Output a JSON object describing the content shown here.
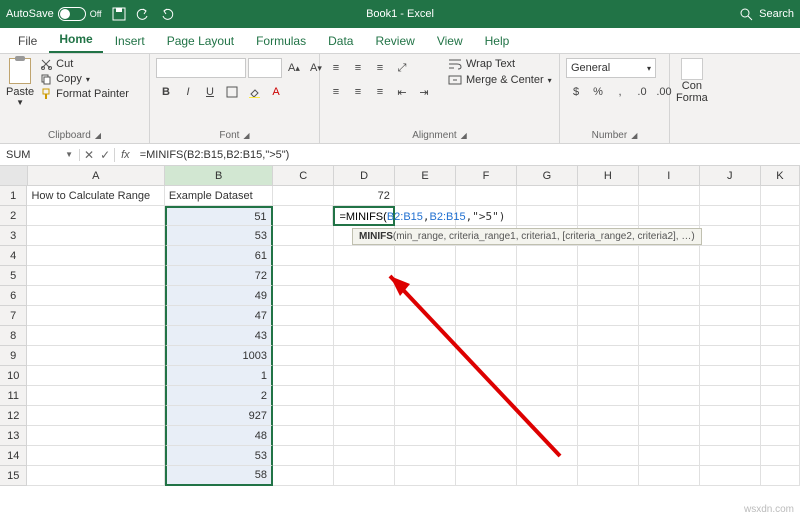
{
  "titlebar": {
    "autosave": "AutoSave",
    "autosave_state": "Off",
    "title": "Book1 - Excel",
    "search": "Search"
  },
  "tabs": {
    "file": "File",
    "home": "Home",
    "insert": "Insert",
    "pagelayout": "Page Layout",
    "formulas": "Formulas",
    "data": "Data",
    "review": "Review",
    "view": "View",
    "help": "Help"
  },
  "ribbon": {
    "clipboard": {
      "paste": "Paste",
      "cut": "Cut",
      "copy": "Copy",
      "format_painter": "Format Painter",
      "label": "Clipboard"
    },
    "font": {
      "row2": {
        "bold": "B",
        "italic": "I",
        "underline": "U"
      },
      "label": "Font"
    },
    "alignment": {
      "wrap": "Wrap Text",
      "merge": "Merge & Center",
      "label": "Alignment"
    },
    "number": {
      "format": "General",
      "label": "Number"
    },
    "styles": {
      "cond": "Con",
      "cond2": "Forma",
      "label": ""
    }
  },
  "fxbar": {
    "namebox": "SUM",
    "fx": "fx",
    "formula": "=MINIFS(B2:B15,B2:B15,\">5\")"
  },
  "columns": [
    "A",
    "B",
    "C",
    "D",
    "E",
    "F",
    "G",
    "H",
    "I",
    "J",
    "K"
  ],
  "rows": [
    "1",
    "2",
    "3",
    "4",
    "5",
    "6",
    "7",
    "8",
    "9",
    "10",
    "11",
    "12",
    "13",
    "14",
    "15"
  ],
  "cells": {
    "A1": "How to Calculate Range",
    "B1": "Example Dataset",
    "D1": "72",
    "B2": "51",
    "B3": "53",
    "B4": "61",
    "B5": "72",
    "B6": "49",
    "B7": "47",
    "B8": "43",
    "B9": "1003",
    "B10": "1",
    "B11": "2",
    "B12": "927",
    "B13": "48",
    "B14": "53",
    "B15": "58"
  },
  "edit": {
    "prefix": "=MINIFS(",
    "range1": "B2:B15",
    "sep1": ",",
    "range2": "B2:B15",
    "sep2": ",",
    "crit": "\">5\")"
  },
  "tooltip": {
    "fn": "MINIFS",
    "sig": "(min_range, criteria_range1, criteria1, [criteria_range2, criteria2], …)"
  },
  "watermark": "wsxdn.com"
}
